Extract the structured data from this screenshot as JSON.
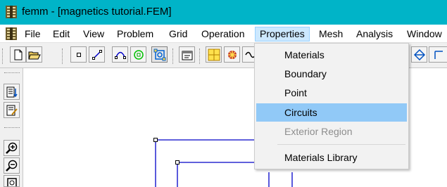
{
  "window": {
    "title": "femm - [magnetics tutorial.FEM]"
  },
  "menubar": {
    "items": [
      {
        "label": "File"
      },
      {
        "label": "Edit"
      },
      {
        "label": "View"
      },
      {
        "label": "Problem"
      },
      {
        "label": "Grid"
      },
      {
        "label": "Operation"
      },
      {
        "label": "Properties"
      },
      {
        "label": "Mesh"
      },
      {
        "label": "Analysis"
      },
      {
        "label": "Window"
      }
    ],
    "active": "Properties"
  },
  "properties_menu": {
    "items": [
      {
        "label": "Materials",
        "state": "normal"
      },
      {
        "label": "Boundary",
        "state": "normal"
      },
      {
        "label": "Point",
        "state": "normal"
      },
      {
        "label": "Circuits",
        "state": "highlighted"
      },
      {
        "label": "Exterior Region",
        "state": "disabled"
      },
      {
        "label": "Materials Library",
        "state": "normal"
      }
    ]
  },
  "toolbar": {
    "icons": [
      "new-file-icon",
      "open-folder-icon",
      "node-mode-icon",
      "segment-mode-icon",
      "arc-segment-mode-icon",
      "block-label-mode-icon",
      "group-mode-icon",
      "properties-icon",
      "zoom-window-icon",
      "mesh-icon",
      "analyze-icon"
    ]
  },
  "left_toolbar": {
    "icons": [
      "snap-grid-icon",
      "grid-properties-icon",
      "zoom-in-icon",
      "zoom-out-icon",
      "zoom-natural-icon"
    ]
  },
  "colors": {
    "titlebar": "#00b4c8",
    "menu_active": "#cce8ff",
    "menu_highlight": "#91c9f7",
    "geometry_line": "#0000c8"
  }
}
